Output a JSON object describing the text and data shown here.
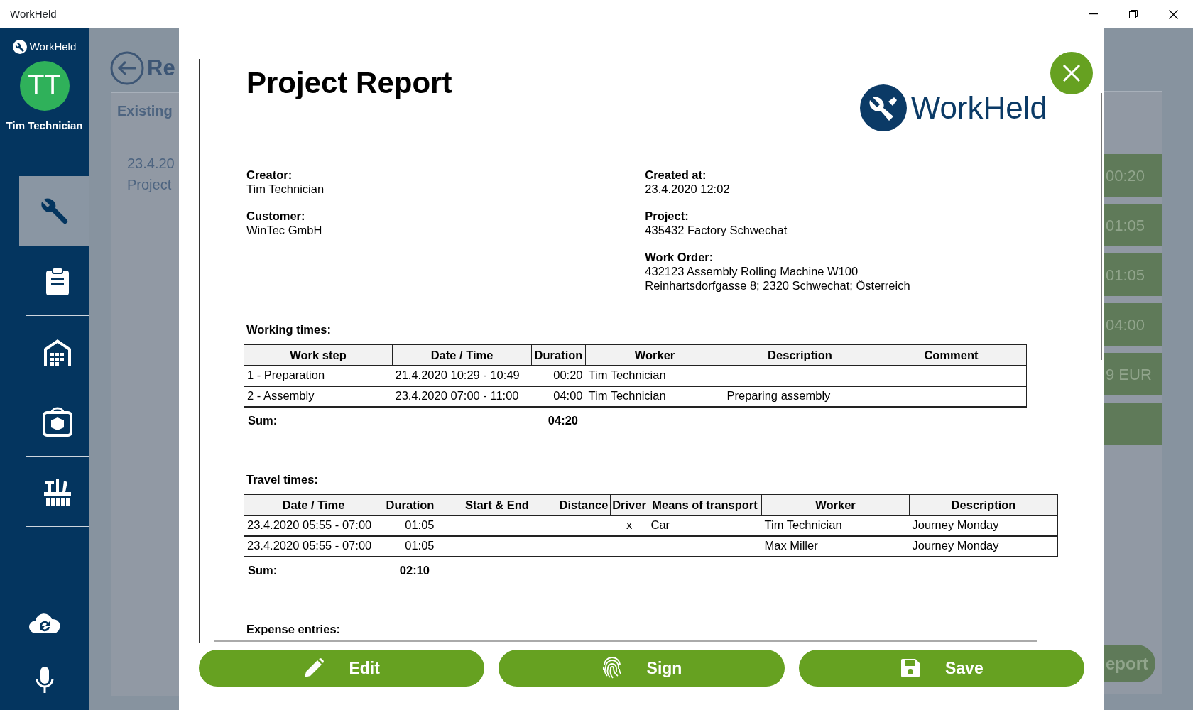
{
  "window": {
    "title": "WorkHeld"
  },
  "sidebar": {
    "brand": "WorkHeld",
    "avatar": "TT",
    "user_name": "Tim Technician",
    "nav_items": [
      {
        "kind": "wrench",
        "selected": true
      },
      {
        "kind": "clipboard",
        "selected": false
      },
      {
        "kind": "warehouse",
        "selected": false
      },
      {
        "kind": "package",
        "selected": false
      },
      {
        "kind": "tools",
        "selected": false
      }
    ],
    "bottom_items": [
      {
        "kind": "sync"
      },
      {
        "kind": "microphone"
      }
    ]
  },
  "background": {
    "title": "Re",
    "section": "Existing",
    "entry_lines": [
      "23.4.20",
      "Project"
    ],
    "tiles": [
      {
        "kind": "text",
        "text": "00:20"
      },
      {
        "kind": "text",
        "text": "01:05"
      },
      {
        "kind": "text",
        "text": "01:05"
      },
      {
        "kind": "text",
        "text": "04:00"
      },
      {
        "kind": "text",
        "text": "9 EUR"
      },
      {
        "kind": "blank"
      }
    ],
    "button": "eport"
  },
  "report": {
    "title": "Project Report",
    "logo": "WorkHeld",
    "fields_left": [
      {
        "label": "Creator:",
        "value": [
          "Tim Technician"
        ]
      },
      {
        "label": "Customer:",
        "value": [
          "WinTec GmbH"
        ]
      }
    ],
    "fields_right": [
      {
        "label": "Created at:",
        "value": [
          "23.4.2020 12:02"
        ]
      },
      {
        "label": "Project:",
        "value": [
          "435432 Factory Schwechat"
        ]
      },
      {
        "label": "Work Order:",
        "value": [
          "432123 Assembly Rolling Machine W100",
          "Reinhartsdorfgasse 8; 2320 Schwechat; Österreich"
        ]
      }
    ],
    "sections": [
      {
        "kind": "working",
        "heading": "Working times:",
        "columns": [
          "Work step",
          "Date / Time",
          "Duration",
          "Worker",
          "Description",
          "Comment"
        ],
        "rows": [
          [
            "1 - Preparation",
            "21.4.2020 10:29 - 10:49",
            "00:20",
            "Tim Technician",
            null,
            null
          ],
          [
            "2 - Assembly",
            "23.4.2020 07:00 - 11:00",
            "04:00",
            "Tim Technician",
            "Preparing assembly",
            null
          ]
        ],
        "sum_label": "Sum:",
        "sum": "04:20"
      },
      {
        "kind": "travel",
        "heading": "Travel times:",
        "columns": [
          "Date / Time",
          "Duration",
          "Start & End",
          "Distance",
          "Driver",
          "Means of transport",
          "Worker",
          "Description"
        ],
        "rows": [
          [
            "23.4.2020 05:55 - 07:00",
            "01:05",
            null,
            null,
            "x",
            "Car",
            "Tim Technician",
            "Journey Monday"
          ],
          [
            "23.4.2020 05:55 - 07:00",
            "01:05",
            null,
            null,
            null,
            null,
            "Max Miller",
            "Journey Monday"
          ]
        ],
        "sum_label": "Sum:",
        "sum": "02:10"
      },
      {
        "kind": "expense",
        "heading": "Expense entries:"
      }
    ]
  },
  "actions": [
    {
      "kind": "edit",
      "label": "Edit"
    },
    {
      "kind": "sign",
      "label": "Sign"
    },
    {
      "kind": "save",
      "label": "Save"
    }
  ]
}
